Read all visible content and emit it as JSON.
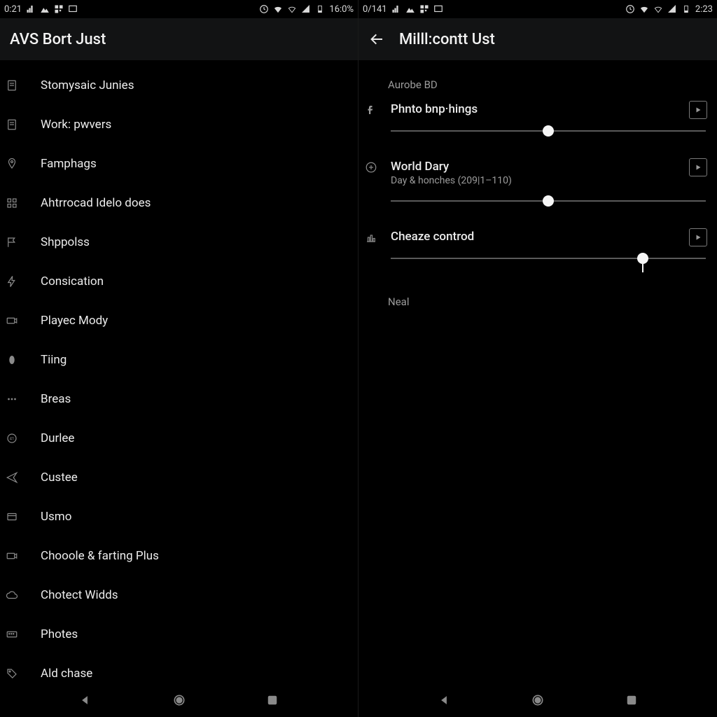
{
  "left": {
    "status": {
      "time": "0:21",
      "battery": "16:0%"
    },
    "appbar": {
      "title": "AVS Bort Just"
    },
    "list": [
      {
        "icon": "doc-icon",
        "label": "Stomysaic Junies"
      },
      {
        "icon": "doc-icon",
        "label": "Work: pwvers"
      },
      {
        "icon": "pin-icon",
        "label": "Famphags"
      },
      {
        "icon": "grid-icon",
        "label": "Ahtrrocad Idelo does"
      },
      {
        "icon": "flag-icon",
        "label": "Shppolss"
      },
      {
        "icon": "bolt-icon",
        "label": "Consication"
      },
      {
        "icon": "camera-icon",
        "label": "Playec Mody"
      },
      {
        "icon": "oval-icon",
        "label": "Tiing"
      },
      {
        "icon": "dots-icon",
        "label": "Breas"
      },
      {
        "icon": "circle-icon",
        "label": "Durlee"
      },
      {
        "icon": "send-icon",
        "label": "Custee"
      },
      {
        "icon": "box-icon",
        "label": "Usmo"
      },
      {
        "icon": "camera-icon",
        "label": "Chooole & farting Plus"
      },
      {
        "icon": "cloud-icon",
        "label": "Chotect Widds"
      },
      {
        "icon": "keyboard-icon",
        "label": "Photes"
      },
      {
        "icon": "tag-icon",
        "label": "Ald chase"
      }
    ]
  },
  "right": {
    "status": {
      "time": "0/141",
      "clock": "2:23"
    },
    "appbar": {
      "title": "Milll:contt Ust"
    },
    "section1": "Aurobe BD",
    "sliders": [
      {
        "icon": "f-icon",
        "title": "Phnto bnp·hings",
        "sub": "",
        "value": 50,
        "tick": false
      },
      {
        "icon": "plus-circle-icon",
        "title": "World Dary",
        "sub": "Day & honches (209|1–110)",
        "value": 50,
        "tick": false
      },
      {
        "icon": "bar-chart-icon",
        "title": "Cheaze controd",
        "sub": "",
        "value": 80,
        "tick": true
      }
    ],
    "section2": "Neal"
  }
}
